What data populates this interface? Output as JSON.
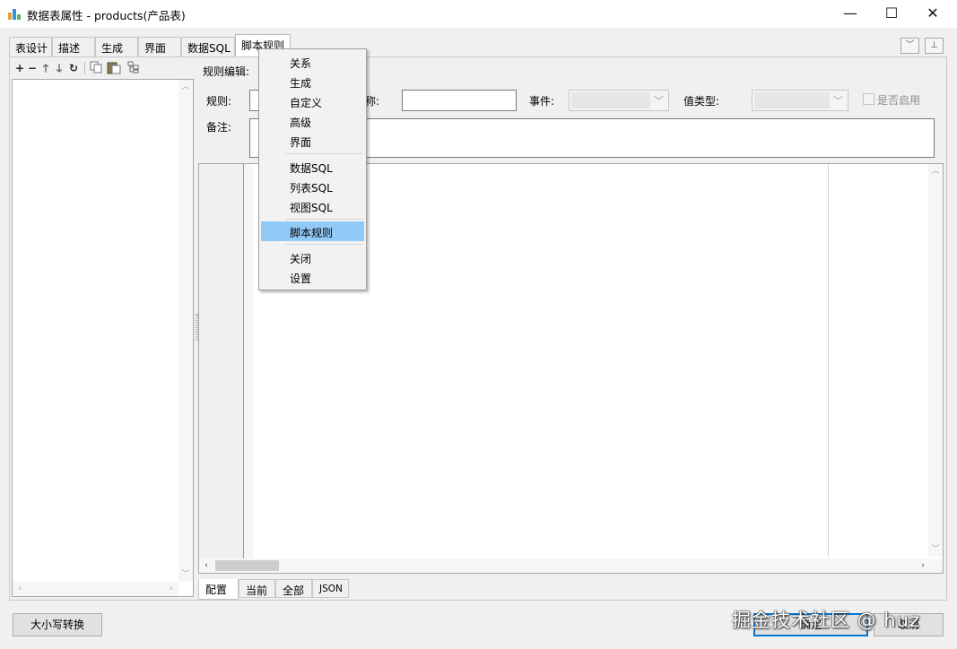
{
  "window": {
    "title": "数据表属性 - products(产品表)",
    "minimize_glyph": "—",
    "maximize_glyph": "☐",
    "close_glyph": "✕"
  },
  "tabs": [
    "表设计",
    "描述",
    "生成",
    "界面",
    "数据SQL",
    "脚本规则"
  ],
  "active_tab": "脚本规则",
  "left_toolbar": {
    "icons": [
      "add-icon",
      "remove-icon",
      "move-up-icon",
      "move-down-icon",
      "refresh-icon",
      "copy-icon",
      "paste-icon",
      "tree-icon"
    ]
  },
  "rule_edit_label": "规则编辑:",
  "form": {
    "rule_label": "规则:",
    "name_label": "称:",
    "name_value": "",
    "event_label": "事件:",
    "event_value": "",
    "value_type_label": "值类型:",
    "value_type_value": "",
    "enabled_label": "是否启用",
    "enabled_checked": false,
    "remark_label": "备注:",
    "remark_value": ""
  },
  "bottom_tabs": [
    "配置",
    "当前",
    "全部",
    "JSON"
  ],
  "active_bottom_tab": "配置",
  "buttons": {
    "case_convert": "大小写转换",
    "ok": "确定",
    "cancel": "取消"
  },
  "context_menu": {
    "group1": [
      "关系",
      "生成",
      "自定义",
      "高级",
      "界面"
    ],
    "group2": [
      "数据SQL",
      "列表SQL",
      "视图SQL"
    ],
    "group3": [
      "脚本规则"
    ],
    "group4": [
      "关闭",
      "设置"
    ],
    "highlighted": "脚本规则"
  },
  "watermark": "掘金技术社区 @ huz",
  "colors": {
    "menu_highlight": "#91c9f7",
    "default_button_border": "#0078d7"
  }
}
